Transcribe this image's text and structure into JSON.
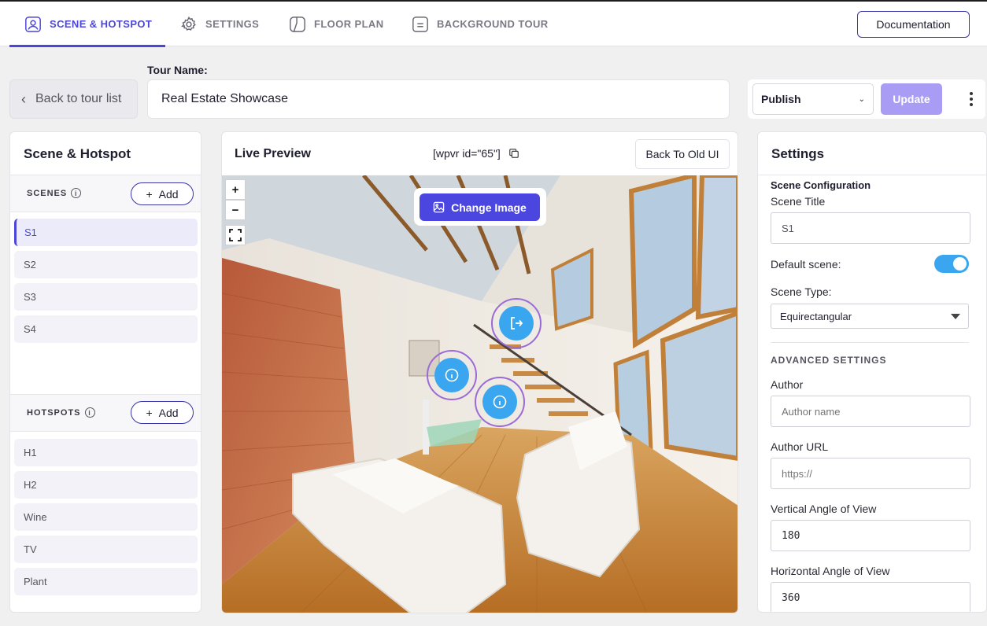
{
  "nav": {
    "tabs": [
      {
        "label": "SCENE & HOTSPOT",
        "icon": "scene-icon",
        "active": true
      },
      {
        "label": "SETTINGS",
        "icon": "gear-icon",
        "active": false
      },
      {
        "label": "FLOOR PLAN",
        "icon": "floor-plan-icon",
        "active": false
      },
      {
        "label": "BACKGROUND TOUR",
        "icon": "background-tour-icon",
        "active": false
      }
    ],
    "documentation_label": "Documentation"
  },
  "toolbar": {
    "back_label": "Back to tour list",
    "tour_name_label": "Tour Name:",
    "tour_name_value": "Real Estate Showcase",
    "publish_value": "Publish",
    "update_label": "Update"
  },
  "scene_panel": {
    "title": "Scene & Hotspot",
    "scenes_label": "SCENES",
    "hotspots_label": "HOTSPOTS",
    "add_label": "Add",
    "scenes": [
      "S1",
      "S2",
      "S3",
      "S4"
    ],
    "active_scene": "S1",
    "hotspots": [
      "H1",
      "H2",
      "Wine",
      "TV",
      "Plant"
    ]
  },
  "preview": {
    "title": "Live Preview",
    "shortcode": "[wpvr id=\"65\"]",
    "old_ui_label": "Back To Old UI",
    "zoom_in": "+",
    "zoom_out": "−",
    "change_image_label": "Change Image"
  },
  "settings": {
    "title": "Settings",
    "scene_config_label": "Scene Configuration",
    "scene_title_label": "Scene Title",
    "scene_title_value": "S1",
    "default_scene_label": "Default scene:",
    "default_scene_on": true,
    "scene_type_label": "Scene Type:",
    "scene_type_value": "Equirectangular",
    "advanced_label": "ADVANCED SETTINGS",
    "author_label": "Author",
    "author_placeholder": "Author name",
    "author_url_label": "Author URL",
    "author_url_placeholder": "https://",
    "vertical_label": "Vertical Angle of View",
    "vertical_value": "180",
    "horizontal_label": "Horizontal Angle of View",
    "horizontal_value": "360"
  },
  "colors": {
    "accent": "#4b46d8",
    "hotspot": "#3aa6f0",
    "update_button": "#a89cf5"
  }
}
